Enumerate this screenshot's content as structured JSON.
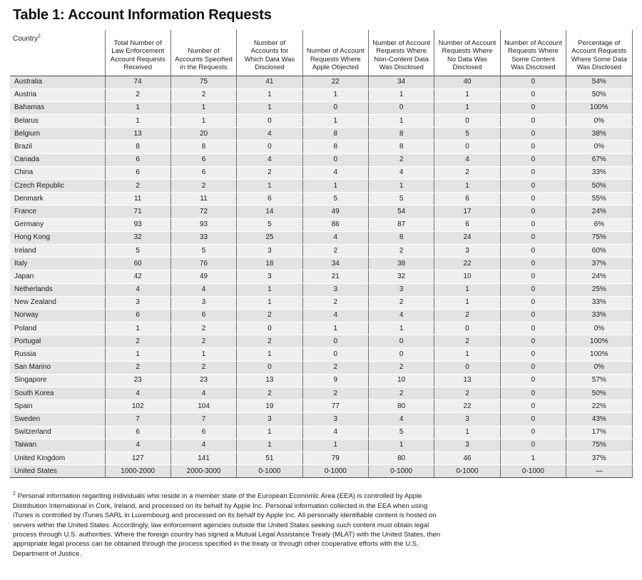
{
  "document": {
    "title": "Table 1: Account Information Requests",
    "footnote_marker": "2",
    "footnote_text": "Personal information regarding individuals who reside in a member state of the European Economic Area (EEA) is controlled by Apple Distribution International in Cork, Ireland, and processed on its behalf by Apple Inc. Personal information collected in the EEA when using iTunes is controlled by iTunes SARL in Luxembourg and processed on its behalf by Apple Inc. All personally identifiable content is hosted on servers within the United States. Accordingly, law enforcement agencies outside the United States seeking such content must obtain legal process through U.S. authorities. Where the foreign country has signed a Mutual Legal Assistance Treaty (MLAT) with the United States, then appropriate legal process can be obtained through the process specified in the treaty or through other cooperative efforts with the U.S. Department of Justice."
  },
  "table": {
    "country_header": "Country",
    "country_header_marker": "2",
    "columns": [
      "Total Number of Law Enforcement Account Requests Received",
      "Number of Accounts Specified in the Requests",
      "Number of Accounts for Which Data Was Disclosed",
      "Number of Account Requests Where Apple Objected",
      "Number of Account Requests Where Non-Content Data Was Disclosed",
      "Number of Account Requests Where No Data Was Disclosed",
      "Number of Account Requests Where Some Content Was Disclosed",
      "Percentage of Account Requests Where Some Data Was Disclosed"
    ],
    "rows": [
      {
        "country": "Australia",
        "values": [
          "74",
          "75",
          "41",
          "22",
          "34",
          "40",
          "0",
          "54%"
        ]
      },
      {
        "country": "Austria",
        "values": [
          "2",
          "2",
          "1",
          "1",
          "1",
          "1",
          "0",
          "50%"
        ]
      },
      {
        "country": "Bahamas",
        "values": [
          "1",
          "1",
          "1",
          "0",
          "0",
          "1",
          "0",
          "100%"
        ]
      },
      {
        "country": "Belarus",
        "values": [
          "1",
          "1",
          "0",
          "1",
          "1",
          "0",
          "0",
          "0%"
        ]
      },
      {
        "country": "Belgium",
        "values": [
          "13",
          "20",
          "4",
          "8",
          "8",
          "5",
          "0",
          "38%"
        ]
      },
      {
        "country": "Brazil",
        "values": [
          "8",
          "8",
          "0",
          "8",
          "8",
          "0",
          "0",
          "0%"
        ]
      },
      {
        "country": "Canada",
        "values": [
          "6",
          "6",
          "4",
          "0",
          "2",
          "4",
          "0",
          "67%"
        ]
      },
      {
        "country": "China",
        "values": [
          "6",
          "6",
          "2",
          "4",
          "4",
          "2",
          "0",
          "33%"
        ]
      },
      {
        "country": "Czech Republic",
        "values": [
          "2",
          "2",
          "1",
          "1",
          "1",
          "1",
          "0",
          "50%"
        ]
      },
      {
        "country": "Denmark",
        "values": [
          "11",
          "11",
          "6",
          "5",
          "5",
          "6",
          "0",
          "55%"
        ]
      },
      {
        "country": "France",
        "values": [
          "71",
          "72",
          "14",
          "49",
          "54",
          "17",
          "0",
          "24%"
        ]
      },
      {
        "country": "Germany",
        "values": [
          "93",
          "93",
          "5",
          "86",
          "87",
          "6",
          "0",
          "6%"
        ]
      },
      {
        "country": "Hong Kong",
        "values": [
          "32",
          "33",
          "25",
          "4",
          "8",
          "24",
          "0",
          "75%"
        ]
      },
      {
        "country": "Ireland",
        "values": [
          "5",
          "5",
          "3",
          "2",
          "2",
          "3",
          "0",
          "60%"
        ]
      },
      {
        "country": "Italy",
        "values": [
          "60",
          "76",
          "18",
          "34",
          "38",
          "22",
          "0",
          "37%"
        ]
      },
      {
        "country": "Japan",
        "values": [
          "42",
          "49",
          "3",
          "21",
          "32",
          "10",
          "0",
          "24%"
        ]
      },
      {
        "country": "Netherlands",
        "values": [
          "4",
          "4",
          "1",
          "3",
          "3",
          "1",
          "0",
          "25%"
        ]
      },
      {
        "country": "New Zealand",
        "values": [
          "3",
          "3",
          "1",
          "2",
          "2",
          "1",
          "0",
          "33%"
        ]
      },
      {
        "country": "Norway",
        "values": [
          "6",
          "6",
          "2",
          "4",
          "4",
          "2",
          "0",
          "33%"
        ]
      },
      {
        "country": "Poland",
        "values": [
          "1",
          "2",
          "0",
          "1",
          "1",
          "0",
          "0",
          "0%"
        ]
      },
      {
        "country": "Portugal",
        "values": [
          "2",
          "2",
          "2",
          "0",
          "0",
          "2",
          "0",
          "100%"
        ]
      },
      {
        "country": "Russia",
        "values": [
          "1",
          "1",
          "1",
          "0",
          "0",
          "1",
          "0",
          "100%"
        ]
      },
      {
        "country": "San Marino",
        "values": [
          "2",
          "2",
          "0",
          "2",
          "2",
          "0",
          "0",
          "0%"
        ]
      },
      {
        "country": "Singapore",
        "values": [
          "23",
          "23",
          "13",
          "9",
          "10",
          "13",
          "0",
          "57%"
        ]
      },
      {
        "country": "South Korea",
        "values": [
          "4",
          "4",
          "2",
          "2",
          "2",
          "2",
          "0",
          "50%"
        ]
      },
      {
        "country": "Spain",
        "values": [
          "102",
          "104",
          "19",
          "77",
          "80",
          "22",
          "0",
          "22%"
        ]
      },
      {
        "country": "Sweden",
        "values": [
          "7",
          "7",
          "3",
          "3",
          "4",
          "3",
          "0",
          "43%"
        ]
      },
      {
        "country": "Switzerland",
        "values": [
          "6",
          "6",
          "1",
          "4",
          "5",
          "1",
          "0",
          "17%"
        ]
      },
      {
        "country": "Taiwan",
        "values": [
          "4",
          "4",
          "1",
          "1",
          "1",
          "3",
          "0",
          "75%"
        ]
      },
      {
        "country": "United Kingdom",
        "values": [
          "127",
          "141",
          "51",
          "79",
          "80",
          "46",
          "1",
          "37%"
        ]
      },
      {
        "country": "United States",
        "values": [
          "1000-2000",
          "2000-3000",
          "0-1000",
          "0-1000",
          "0-1000",
          "0-1000",
          "0-1000",
          "—"
        ]
      }
    ]
  },
  "colors": {
    "row_odd": "#e3e3e3",
    "row_even": "#efefef",
    "rule": "#4a4a4a",
    "column_separator": "#6e6e6e",
    "text": "#1b1b1b",
    "background": "#ffffff"
  }
}
